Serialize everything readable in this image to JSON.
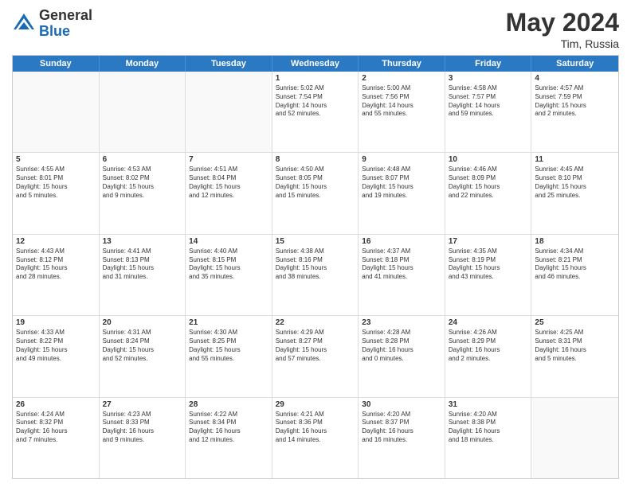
{
  "header": {
    "logo_general": "General",
    "logo_blue": "Blue",
    "month": "May 2024",
    "location": "Tim, Russia"
  },
  "days_of_week": [
    "Sunday",
    "Monday",
    "Tuesday",
    "Wednesday",
    "Thursday",
    "Friday",
    "Saturday"
  ],
  "weeks": [
    [
      {
        "day": "",
        "lines": []
      },
      {
        "day": "",
        "lines": []
      },
      {
        "day": "",
        "lines": []
      },
      {
        "day": "1",
        "lines": [
          "Sunrise: 5:02 AM",
          "Sunset: 7:54 PM",
          "Daylight: 14 hours",
          "and 52 minutes."
        ]
      },
      {
        "day": "2",
        "lines": [
          "Sunrise: 5:00 AM",
          "Sunset: 7:56 PM",
          "Daylight: 14 hours",
          "and 55 minutes."
        ]
      },
      {
        "day": "3",
        "lines": [
          "Sunrise: 4:58 AM",
          "Sunset: 7:57 PM",
          "Daylight: 14 hours",
          "and 59 minutes."
        ]
      },
      {
        "day": "4",
        "lines": [
          "Sunrise: 4:57 AM",
          "Sunset: 7:59 PM",
          "Daylight: 15 hours",
          "and 2 minutes."
        ]
      }
    ],
    [
      {
        "day": "5",
        "lines": [
          "Sunrise: 4:55 AM",
          "Sunset: 8:01 PM",
          "Daylight: 15 hours",
          "and 5 minutes."
        ]
      },
      {
        "day": "6",
        "lines": [
          "Sunrise: 4:53 AM",
          "Sunset: 8:02 PM",
          "Daylight: 15 hours",
          "and 9 minutes."
        ]
      },
      {
        "day": "7",
        "lines": [
          "Sunrise: 4:51 AM",
          "Sunset: 8:04 PM",
          "Daylight: 15 hours",
          "and 12 minutes."
        ]
      },
      {
        "day": "8",
        "lines": [
          "Sunrise: 4:50 AM",
          "Sunset: 8:05 PM",
          "Daylight: 15 hours",
          "and 15 minutes."
        ]
      },
      {
        "day": "9",
        "lines": [
          "Sunrise: 4:48 AM",
          "Sunset: 8:07 PM",
          "Daylight: 15 hours",
          "and 19 minutes."
        ]
      },
      {
        "day": "10",
        "lines": [
          "Sunrise: 4:46 AM",
          "Sunset: 8:09 PM",
          "Daylight: 15 hours",
          "and 22 minutes."
        ]
      },
      {
        "day": "11",
        "lines": [
          "Sunrise: 4:45 AM",
          "Sunset: 8:10 PM",
          "Daylight: 15 hours",
          "and 25 minutes."
        ]
      }
    ],
    [
      {
        "day": "12",
        "lines": [
          "Sunrise: 4:43 AM",
          "Sunset: 8:12 PM",
          "Daylight: 15 hours",
          "and 28 minutes."
        ]
      },
      {
        "day": "13",
        "lines": [
          "Sunrise: 4:41 AM",
          "Sunset: 8:13 PM",
          "Daylight: 15 hours",
          "and 31 minutes."
        ]
      },
      {
        "day": "14",
        "lines": [
          "Sunrise: 4:40 AM",
          "Sunset: 8:15 PM",
          "Daylight: 15 hours",
          "and 35 minutes."
        ]
      },
      {
        "day": "15",
        "lines": [
          "Sunrise: 4:38 AM",
          "Sunset: 8:16 PM",
          "Daylight: 15 hours",
          "and 38 minutes."
        ]
      },
      {
        "day": "16",
        "lines": [
          "Sunrise: 4:37 AM",
          "Sunset: 8:18 PM",
          "Daylight: 15 hours",
          "and 41 minutes."
        ]
      },
      {
        "day": "17",
        "lines": [
          "Sunrise: 4:35 AM",
          "Sunset: 8:19 PM",
          "Daylight: 15 hours",
          "and 43 minutes."
        ]
      },
      {
        "day": "18",
        "lines": [
          "Sunrise: 4:34 AM",
          "Sunset: 8:21 PM",
          "Daylight: 15 hours",
          "and 46 minutes."
        ]
      }
    ],
    [
      {
        "day": "19",
        "lines": [
          "Sunrise: 4:33 AM",
          "Sunset: 8:22 PM",
          "Daylight: 15 hours",
          "and 49 minutes."
        ]
      },
      {
        "day": "20",
        "lines": [
          "Sunrise: 4:31 AM",
          "Sunset: 8:24 PM",
          "Daylight: 15 hours",
          "and 52 minutes."
        ]
      },
      {
        "day": "21",
        "lines": [
          "Sunrise: 4:30 AM",
          "Sunset: 8:25 PM",
          "Daylight: 15 hours",
          "and 55 minutes."
        ]
      },
      {
        "day": "22",
        "lines": [
          "Sunrise: 4:29 AM",
          "Sunset: 8:27 PM",
          "Daylight: 15 hours",
          "and 57 minutes."
        ]
      },
      {
        "day": "23",
        "lines": [
          "Sunrise: 4:28 AM",
          "Sunset: 8:28 PM",
          "Daylight: 16 hours",
          "and 0 minutes."
        ]
      },
      {
        "day": "24",
        "lines": [
          "Sunrise: 4:26 AM",
          "Sunset: 8:29 PM",
          "Daylight: 16 hours",
          "and 2 minutes."
        ]
      },
      {
        "day": "25",
        "lines": [
          "Sunrise: 4:25 AM",
          "Sunset: 8:31 PM",
          "Daylight: 16 hours",
          "and 5 minutes."
        ]
      }
    ],
    [
      {
        "day": "26",
        "lines": [
          "Sunrise: 4:24 AM",
          "Sunset: 8:32 PM",
          "Daylight: 16 hours",
          "and 7 minutes."
        ]
      },
      {
        "day": "27",
        "lines": [
          "Sunrise: 4:23 AM",
          "Sunset: 8:33 PM",
          "Daylight: 16 hours",
          "and 9 minutes."
        ]
      },
      {
        "day": "28",
        "lines": [
          "Sunrise: 4:22 AM",
          "Sunset: 8:34 PM",
          "Daylight: 16 hours",
          "and 12 minutes."
        ]
      },
      {
        "day": "29",
        "lines": [
          "Sunrise: 4:21 AM",
          "Sunset: 8:36 PM",
          "Daylight: 16 hours",
          "and 14 minutes."
        ]
      },
      {
        "day": "30",
        "lines": [
          "Sunrise: 4:20 AM",
          "Sunset: 8:37 PM",
          "Daylight: 16 hours",
          "and 16 minutes."
        ]
      },
      {
        "day": "31",
        "lines": [
          "Sunrise: 4:20 AM",
          "Sunset: 8:38 PM",
          "Daylight: 16 hours",
          "and 18 minutes."
        ]
      },
      {
        "day": "",
        "lines": []
      }
    ]
  ]
}
